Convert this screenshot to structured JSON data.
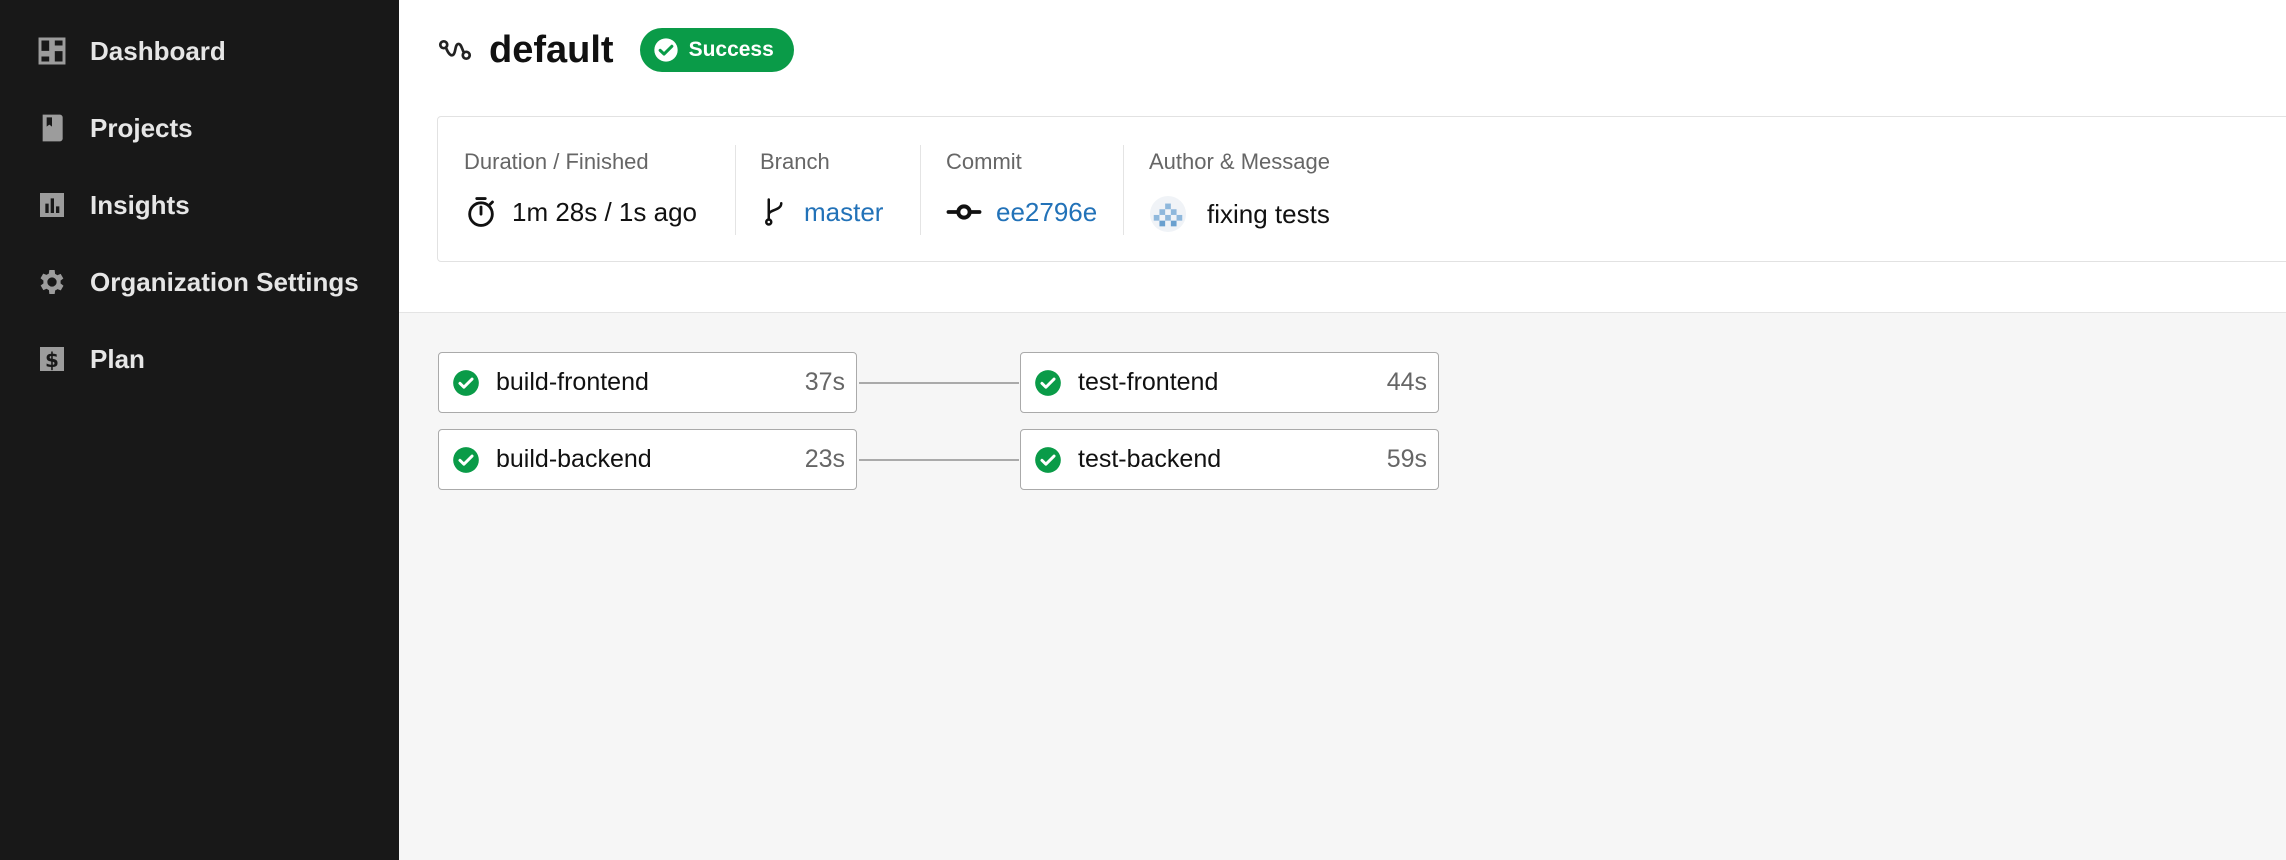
{
  "sidebar": {
    "items": [
      {
        "label": "Dashboard",
        "icon": "dashboard-icon"
      },
      {
        "label": "Projects",
        "icon": "book-icon"
      },
      {
        "label": "Insights",
        "icon": "bar-chart-icon"
      },
      {
        "label": "Organization Settings",
        "icon": "gear-icon"
      },
      {
        "label": "Plan",
        "icon": "dollar-icon"
      }
    ]
  },
  "header": {
    "title": "default",
    "status": "Success",
    "colors": {
      "success": "#0a9b48",
      "link": "#2272b8"
    }
  },
  "summary": {
    "duration_label": "Duration / Finished",
    "duration_value": "1m 28s / 1s ago",
    "branch_label": "Branch",
    "branch_value": "master",
    "commit_label": "Commit",
    "commit_value": "ee2796e",
    "author_label": "Author & Message",
    "author_message": "fixing tests"
  },
  "jobs": [
    {
      "name": "build-frontend",
      "duration": "37s",
      "status": "success"
    },
    {
      "name": "build-backend",
      "duration": "23s",
      "status": "success"
    },
    {
      "name": "test-frontend",
      "duration": "44s",
      "status": "success"
    },
    {
      "name": "test-backend",
      "duration": "59s",
      "status": "success"
    }
  ]
}
